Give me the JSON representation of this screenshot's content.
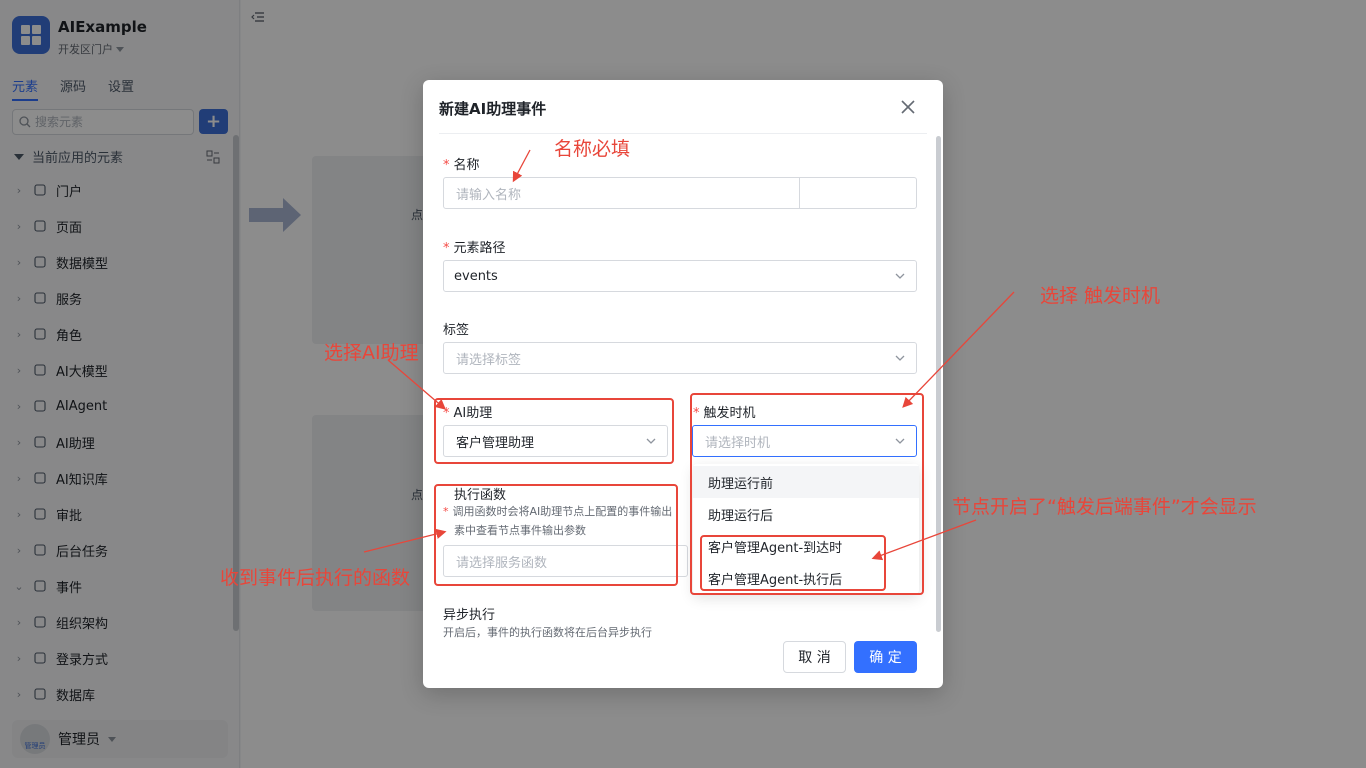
{
  "app": {
    "name": "AIExample",
    "env": "开发区门户"
  },
  "tabs": [
    "元素",
    "源码",
    "设置"
  ],
  "search": {
    "placeholder": "搜索元素"
  },
  "tree": {
    "header": "当前应用的元素",
    "items": [
      {
        "label": "门户",
        "arrow": "›",
        "icon": "home-icon"
      },
      {
        "label": "页面",
        "arrow": "›",
        "icon": "page-icon"
      },
      {
        "label": "数据模型",
        "arrow": "›",
        "icon": "table-icon"
      },
      {
        "label": "服务",
        "arrow": "›",
        "icon": "service-icon"
      },
      {
        "label": "角色",
        "arrow": "›",
        "icon": "role-icon"
      },
      {
        "label": "AI大模型",
        "arrow": "›",
        "icon": "ai-model-icon"
      },
      {
        "label": "AIAgent",
        "arrow": "›",
        "icon": "robot-icon"
      },
      {
        "label": "AI助理",
        "arrow": "›",
        "icon": "ai-assistant-icon"
      },
      {
        "label": "AI知识库",
        "arrow": "›",
        "icon": "knowledge-icon"
      },
      {
        "label": "审批",
        "arrow": "›",
        "icon": "approval-icon"
      },
      {
        "label": "后台任务",
        "arrow": "›",
        "icon": "task-icon"
      },
      {
        "label": "事件",
        "arrow": "⌄",
        "icon": "event-icon"
      },
      {
        "label": "组织架构",
        "arrow": "›",
        "icon": "org-icon"
      },
      {
        "label": "登录方式",
        "arrow": "›",
        "icon": "login-icon"
      },
      {
        "label": "数据库",
        "arrow": "›",
        "icon": "database-icon"
      }
    ]
  },
  "user": {
    "name": "管理员",
    "avatar_text": "管理员"
  },
  "dialog": {
    "title": "新建AI助理事件",
    "name_label": "名称",
    "name_placeholder": "请输入名称",
    "path_label": "元素路径",
    "path_value": "events",
    "tag_label": "标签",
    "tag_placeholder": "请选择标签",
    "assistant_label": "AI助理",
    "assistant_value": "客户管理助理",
    "trigger_label": "触发时机",
    "trigger_placeholder": "请选择时机",
    "func_label": "执行函数",
    "func_hint_1": "调用函数时会将AI助理节点上配置的事件输出",
    "func_hint_2": "素中查看节点事件输出参数",
    "func_placeholder": "请选择服务函数",
    "async_label": "异步执行",
    "async_hint": "开启后，事件的执行函数将在后台异步执行",
    "cancel": "取 消",
    "ok": "确 定",
    "trigger_options": [
      "助理运行前",
      "助理运行后",
      "客户管理Agent-到达时",
      "客户管理Agent-执行后"
    ]
  },
  "annotations": {
    "name_required": "名称必填",
    "choose_trigger": "选择 触发时机",
    "choose_assistant": "选择AI助理",
    "node_event": "节点开启了“触发后端事件”才会显示",
    "exec_func": "收到事件后执行的函数",
    "color": "#e8463a"
  },
  "background": {
    "partial_text_1": "点",
    "partial_text_2": "点"
  }
}
